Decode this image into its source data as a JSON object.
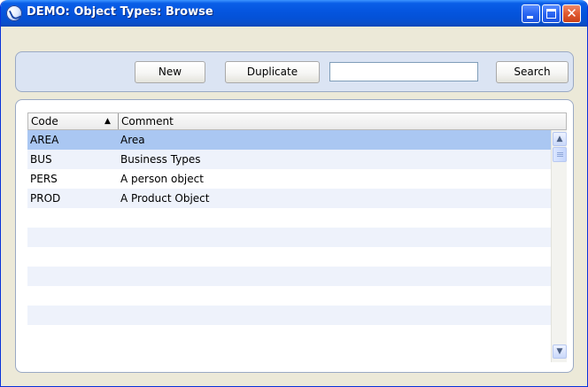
{
  "window": {
    "title": "DEMO: Object Types: Browse",
    "controls": {
      "minimize": "minimize-icon",
      "maximize": "maximize-icon",
      "close": "✕"
    }
  },
  "toolbar": {
    "new_label": "New",
    "duplicate_label": "Duplicate",
    "search_value": "",
    "search_label": "Search"
  },
  "table": {
    "columns": {
      "code": "Code",
      "comment": "Comment"
    },
    "sort": {
      "column": "code",
      "direction": "ascending",
      "icon": "▲"
    },
    "rows": [
      {
        "code": "AREA",
        "comment": "Area",
        "selected": true
      },
      {
        "code": "BUS",
        "comment": "Business Types"
      },
      {
        "code": "PERS",
        "comment": "A person object"
      },
      {
        "code": "PROD",
        "comment": "A Product Object"
      }
    ],
    "empty_rows": 6,
    "scroll_up_icon": "▲",
    "scroll_down_icon": "▼"
  },
  "colors": {
    "titlebar": "#0556e0",
    "window_bg": "#ece9d8",
    "toolbar_bg": "#dbe4f3",
    "selected_row": "#aac7f2",
    "alt_row": "#eef2fb"
  }
}
